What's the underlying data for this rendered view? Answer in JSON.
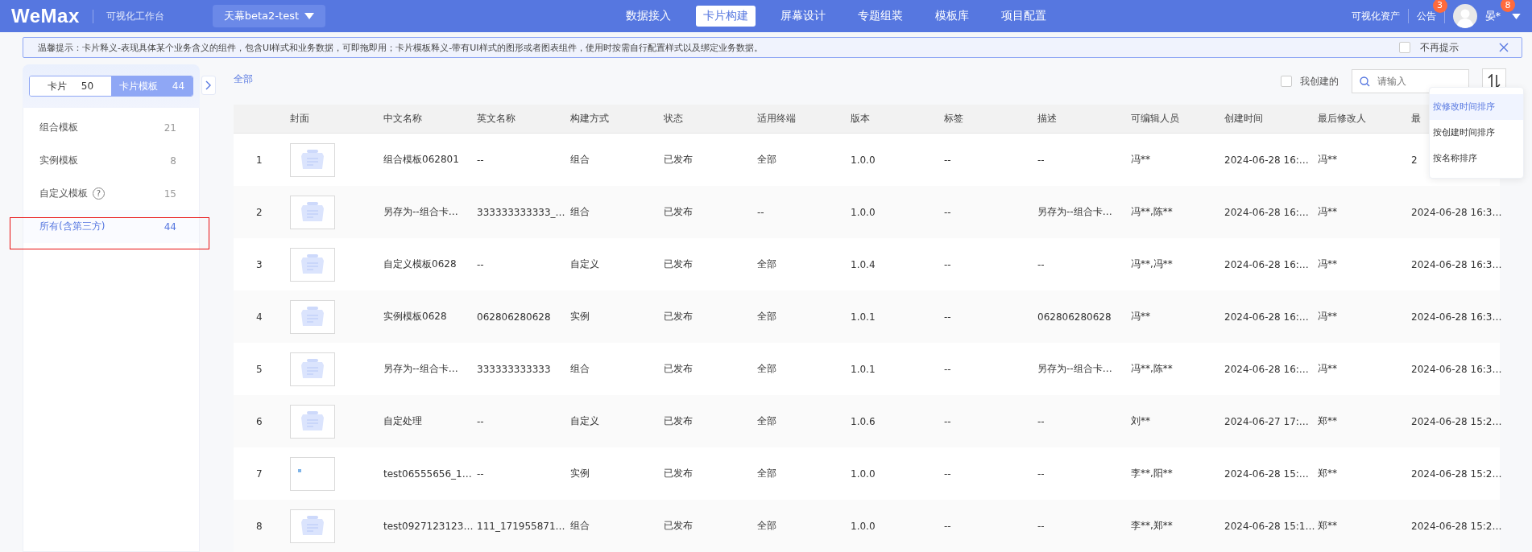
{
  "topbar": {
    "logo": "WeMax",
    "subtitle": "可视化工作台",
    "project": "天幕beta2-test",
    "nav": [
      {
        "label": "数据接入",
        "selected": false
      },
      {
        "label": "卡片构建",
        "selected": true
      },
      {
        "label": "屏幕设计",
        "selected": false
      },
      {
        "label": "专题组装",
        "selected": false
      },
      {
        "label": "模板库",
        "selected": false
      },
      {
        "label": "项目配置",
        "selected": false
      }
    ],
    "assets": "可视化资产",
    "notice": {
      "label": "公告",
      "badge": "3"
    },
    "user": {
      "name": "晏*",
      "badge": "8"
    }
  },
  "tip": {
    "text": "温馨提示：卡片释义-表现具体某个业务含义的组件，包含UI样式和业务数据，可即拖即用；卡片模板释义-带有UI样式的图形或者图表组件，使用时按需自行配置样式以及绑定业务数据。",
    "dismiss": {
      "label": "不再提示",
      "checked": false
    }
  },
  "sidebar": {
    "tabs": [
      {
        "label": "卡片",
        "count": "50",
        "selected": false
      },
      {
        "label": "卡片模板",
        "count": "44",
        "selected": true
      }
    ],
    "items": [
      {
        "label": "组合模板",
        "count": "21",
        "selected": false
      },
      {
        "label": "实例模板",
        "count": "8",
        "selected": false
      },
      {
        "label": "自定义模板",
        "count": "15",
        "help": "?",
        "selected": false
      },
      {
        "label": "所有(含第三方)",
        "count": "44",
        "selected": true
      }
    ]
  },
  "breadcrumb": "全部",
  "toolbar": {
    "mine": {
      "label": "我创建的",
      "checked": false
    },
    "search": {
      "placeholder": "请输入"
    }
  },
  "sort_menu": [
    {
      "label": "按修改时间排序",
      "selected": true
    },
    {
      "label": "按创建时间排序",
      "selected": false
    },
    {
      "label": "按名称排序",
      "selected": false
    }
  ],
  "table": {
    "cover_column": "封面",
    "columns": [
      "中文名称",
      "英文名称",
      "构建方式",
      "状态",
      "适用终端",
      "版本",
      "标签",
      "描述",
      "可编辑人员",
      "创建时间",
      "最后修改人",
      "最"
    ],
    "rows": [
      {
        "index": "1",
        "kind": "placeholder",
        "cells": [
          "组合模板062801",
          "--",
          "组合",
          "已发布",
          "全部",
          "1.0.0",
          "--",
          "--",
          "冯**",
          "2024-06-28 16:…",
          "冯**",
          "2"
        ]
      },
      {
        "index": "2",
        "kind": "placeholder",
        "cells": [
          "另存为--组合卡…",
          "333333333333_…",
          "组合",
          "已发布",
          "--",
          "1.0.0",
          "--",
          "另存为--组合卡…",
          "冯**,陈**",
          "2024-06-28 16:…",
          "冯**",
          "2024-06-28 16:3…"
        ]
      },
      {
        "index": "3",
        "kind": "placeholder",
        "cells": [
          "自定义模板0628",
          "--",
          "自定义",
          "已发布",
          "全部",
          "1.0.4",
          "--",
          "--",
          "冯**,冯**",
          "2024-06-28 16:…",
          "冯**",
          "2024-06-28 16:3…"
        ]
      },
      {
        "index": "4",
        "kind": "placeholder",
        "cells": [
          "实例模板0628",
          "062806280628",
          "实例",
          "已发布",
          "全部",
          "1.0.1",
          "--",
          "062806280628",
          "冯**",
          "2024-06-28 16:…",
          "冯**",
          "2024-06-28 16:3…"
        ]
      },
      {
        "index": "5",
        "kind": "placeholder",
        "cells": [
          "另存为--组合卡…",
          "333333333333",
          "组合",
          "已发布",
          "全部",
          "1.0.1",
          "--",
          "另存为--组合卡…",
          "冯**,陈**",
          "2024-06-28 16:…",
          "冯**",
          "2024-06-28 16:3…"
        ]
      },
      {
        "index": "6",
        "kind": "placeholder",
        "cells": [
          "自定处理",
          "--",
          "自定义",
          "已发布",
          "全部",
          "1.0.6",
          "--",
          "--",
          "刘**",
          "2024-06-27 17:…",
          "郑**",
          "2024-06-28 15:2…"
        ]
      },
      {
        "index": "7",
        "kind": "thumbnail",
        "cells": [
          "test06555656_1…",
          "--",
          "实例",
          "已发布",
          "全部",
          "1.0.0",
          "--",
          "--",
          "李**,阳**",
          "2024-06-28 15:…",
          "郑**",
          "2024-06-28 15:2…"
        ]
      },
      {
        "index": "8",
        "kind": "placeholder",
        "cells": [
          "test0927123123…",
          "111_171955871…",
          "组合",
          "已发布",
          "全部",
          "1.0.0",
          "--",
          "--",
          "李**,郑**",
          "2024-06-28 15:1…",
          "郑**",
          "2024-06-28 15:2…"
        ]
      }
    ]
  }
}
